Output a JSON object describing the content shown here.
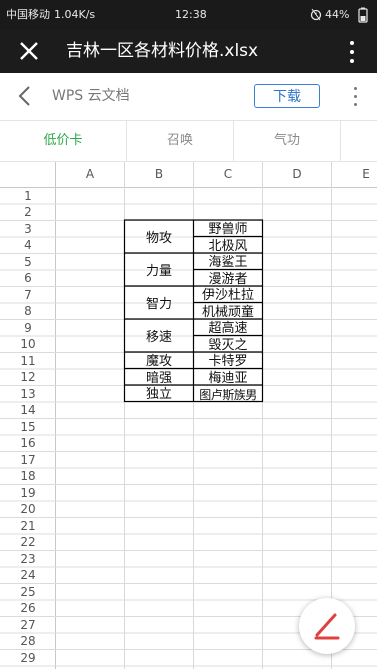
{
  "status_bar": {
    "signal": "中国移动",
    "speed": "1.04K/s",
    "time": "12:38",
    "battery": "44%",
    "icons": [
      "signal-icon",
      "alarm-icon",
      "battery-icon"
    ]
  },
  "app_bar": {
    "title": "吉林一区各材料价格.xlsx",
    "close_icon": "close-icon",
    "menu_icon": "more-vertical-icon"
  },
  "wps_bar": {
    "label": "WPS 云文档",
    "download_label": "下载",
    "back_icon": "chevron-left-icon",
    "more_icon": "more-vertical-icon"
  },
  "sheet_tabs": [
    {
      "label": "低价卡",
      "active": true
    },
    {
      "label": "召唤",
      "active": false
    },
    {
      "label": "气功",
      "active": false
    }
  ],
  "columns": [
    "A",
    "B",
    "C",
    "D",
    "E"
  ],
  "rows": [
    "1",
    "2",
    "3",
    "4",
    "5",
    "6",
    "7",
    "8",
    "9",
    "10",
    "11",
    "12",
    "13",
    "14",
    "15",
    "16",
    "17",
    "18",
    "19",
    "20",
    "21",
    "22",
    "23",
    "24",
    "25",
    "26",
    "27",
    "28",
    "29"
  ],
  "table": {
    "categories": [
      {
        "label": "物攻",
        "items": [
          "野兽师",
          "北极风"
        ]
      },
      {
        "label": "力量",
        "items": [
          "海鲨王",
          "漫游者"
        ]
      },
      {
        "label": "智力",
        "items": [
          "伊沙杜拉",
          "机械顽童"
        ]
      },
      {
        "label": "移速",
        "items": [
          "超高速",
          "毁灭之"
        ]
      },
      {
        "label": "魔攻",
        "items": [
          "卡特罗"
        ]
      },
      {
        "label": "暗强",
        "items": [
          "梅迪亚"
        ]
      },
      {
        "label": "独立",
        "items": [
          "图卢斯族男"
        ]
      }
    ]
  },
  "colors": {
    "active_tab": "#2da84a",
    "download_border": "#3b7fd5",
    "fab_icon": "#e0403e"
  },
  "fab_icon": "edit-pencil-icon"
}
